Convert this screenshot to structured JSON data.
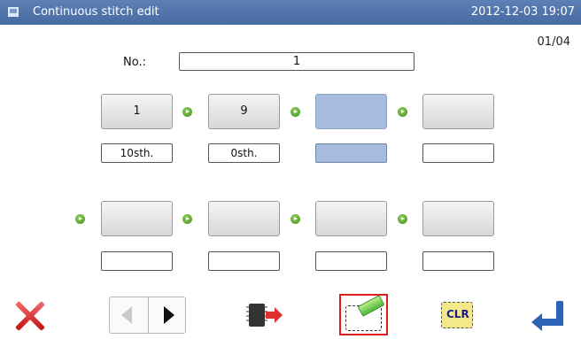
{
  "window": {
    "title": "Continuous stitch edit",
    "datetime": "2012-12-03 19:07",
    "icon": "monitor-icon"
  },
  "page_indicator": "01/04",
  "number_field": {
    "label": "No.:",
    "value": "1"
  },
  "row1": {
    "stitches": [
      {
        "label": "1",
        "count": "10sth."
      },
      {
        "label": "9",
        "count": "0sth."
      },
      {
        "label": "",
        "count": "",
        "selected": true
      },
      {
        "label": "",
        "count": ""
      }
    ]
  },
  "row2": {
    "stitches": [
      {
        "label": "",
        "count": ""
      },
      {
        "label": "",
        "count": ""
      },
      {
        "label": "",
        "count": ""
      },
      {
        "label": "",
        "count": ""
      }
    ]
  },
  "toolbar": {
    "cancel_icon": "red-x-icon",
    "prev_icon": "triangle-left-icon",
    "next_icon": "triangle-right-icon",
    "import_icon": "chip-import-icon",
    "erase_icon": "eraser-icon",
    "clear_label": "CLR",
    "confirm_icon": "enter-arrow-icon"
  },
  "colors": {
    "titlebar": "#4f73aa",
    "selected": "#a7bcdc",
    "arrow": "#4e9e26",
    "highlight_border": "#e01e1e"
  }
}
